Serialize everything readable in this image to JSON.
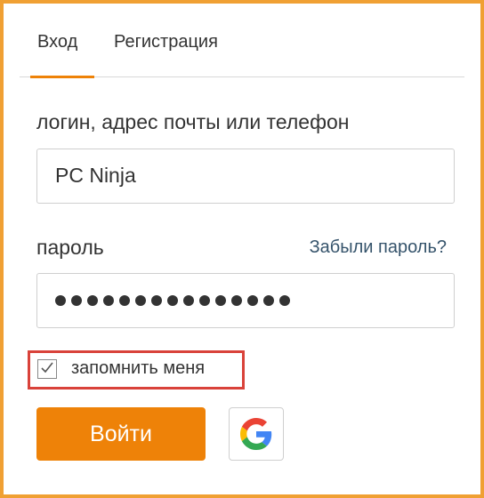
{
  "tabs": {
    "login": "Вход",
    "register": "Регистрация",
    "active": "login"
  },
  "form": {
    "login_label": "логин, адрес почты или телефон",
    "login_value": "PC Ninja",
    "password_label": "пароль",
    "forgot_link": "Забыли пароль?",
    "password_mask_count": 15,
    "remember_label": "запомнить меня",
    "remember_checked": true,
    "submit_label": "Войти",
    "google_icon": "google-icon"
  },
  "colors": {
    "accent": "#ee8208",
    "frame": "#f0a033",
    "highlight": "#d9423a",
    "link": "#35536b"
  }
}
